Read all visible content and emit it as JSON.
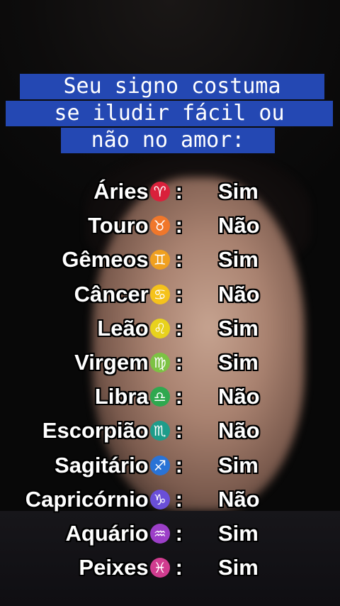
{
  "title": {
    "line1": "Seu signo costuma",
    "line2": "se iludir fácil ou",
    "line3": "não no amor:"
  },
  "signs": [
    {
      "name": "Áries",
      "symbol": "♈",
      "icon": "aries-icon",
      "color": "#d9213b",
      "answer": "Sim"
    },
    {
      "name": "Touro",
      "symbol": "♉",
      "icon": "taurus-icon",
      "color": "#f0772b",
      "answer": "Não"
    },
    {
      "name": "Gêmeos",
      "symbol": "♊",
      "icon": "gemini-icon",
      "color": "#f0a020",
      "answer": "Sim"
    },
    {
      "name": "Câncer",
      "symbol": "♋",
      "icon": "cancer-icon",
      "color": "#f5c21b",
      "answer": "Não"
    },
    {
      "name": "Leão",
      "symbol": "♌",
      "icon": "leo-icon",
      "color": "#e8d21d",
      "answer": "Sim"
    },
    {
      "name": "Virgem",
      "symbol": "♍",
      "icon": "virgo-icon",
      "color": "#7cc243",
      "answer": "Sim"
    },
    {
      "name": "Libra",
      "symbol": "♎",
      "icon": "libra-icon",
      "color": "#2fa84f",
      "answer": "Não"
    },
    {
      "name": "Escorpião",
      "symbol": "♏",
      "icon": "scorpio-icon",
      "color": "#1e9c8a",
      "answer": "Não"
    },
    {
      "name": "Sagitário",
      "symbol": "♐",
      "icon": "sagittarius-icon",
      "color": "#2a73d6",
      "answer": "Sim"
    },
    {
      "name": "Capricórnio",
      "symbol": "♑",
      "icon": "capricorn-icon",
      "color": "#6a4fd8",
      "answer": "Não"
    },
    {
      "name": "Aquário",
      "symbol": "♒",
      "icon": "aquarius-icon",
      "color": "#9c3fc8",
      "answer": "Sim"
    },
    {
      "name": "Peixes",
      "symbol": "♓",
      "icon": "pisces-icon",
      "color": "#d03c8f",
      "answer": "Sim"
    }
  ]
}
